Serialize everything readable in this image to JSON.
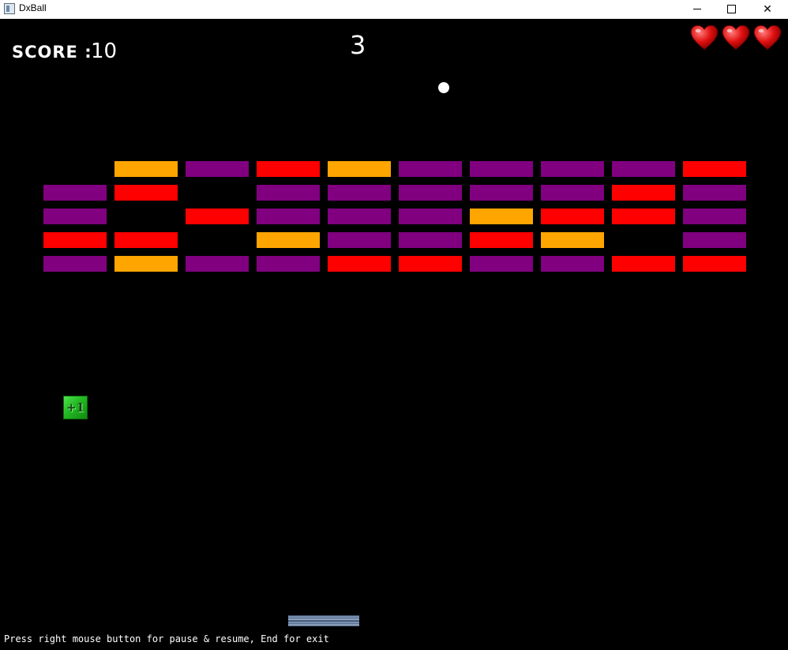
{
  "window": {
    "title": "DxBall",
    "controls": {
      "minimize": "minimize",
      "maximize": "maximize",
      "close": "close"
    }
  },
  "hud": {
    "score_label": "SCORE :",
    "score_value": "10",
    "level": "3",
    "lives": 3
  },
  "colors": {
    "purple": "#800080",
    "red": "#ff0000",
    "orange": "#ffa500",
    "background": "#000000"
  },
  "bricks": [
    [
      null,
      "orange",
      "purple",
      "red",
      "orange",
      "purple",
      "purple",
      "purple",
      "purple",
      "red"
    ],
    [
      "purple",
      "red",
      null,
      "purple",
      "purple",
      "purple",
      "purple",
      "purple",
      "red",
      "purple"
    ],
    [
      "purple",
      null,
      "red",
      "purple",
      "purple",
      "purple",
      "orange",
      "red",
      "red",
      "purple"
    ],
    [
      "red",
      "red",
      null,
      "orange",
      "purple",
      "purple",
      "red",
      "orange",
      null,
      "purple"
    ],
    [
      "purple",
      "orange",
      "purple",
      "purple",
      "red",
      "red",
      "purple",
      "purple",
      "red",
      "red"
    ]
  ],
  "powerup": {
    "label": "+1"
  },
  "footer": {
    "hint": "Press right mouse button for pause & resume, End for exit"
  }
}
